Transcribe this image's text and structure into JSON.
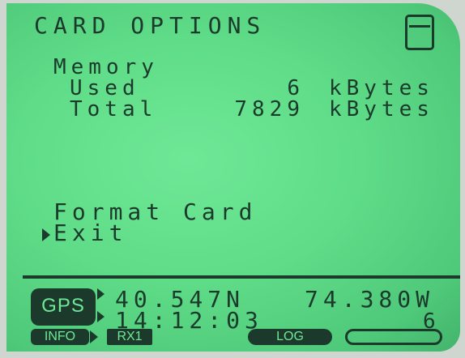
{
  "screen": {
    "title": "CARD OPTIONS"
  },
  "memory": {
    "label": "Memory",
    "used": {
      "label": "Used",
      "value": "6",
      "unit": "kBytes"
    },
    "total": {
      "label": "Total",
      "value": "7829",
      "unit": "kBytes"
    }
  },
  "menu": {
    "items": [
      {
        "label": "Format Card",
        "selected": false
      },
      {
        "label": "Exit",
        "selected": true
      }
    ]
  },
  "status": {
    "gps_label": "GPS",
    "latitude": "40.547N",
    "longitude": "74.380W",
    "time": "14:12:03",
    "satellites": "6",
    "info_label": "INFO",
    "rx_label": "RX1",
    "log_label": "LOG",
    "log_fill": 0.0
  },
  "icons": {
    "card": "sd-card-icon",
    "cursor": "menu-cursor-icon"
  },
  "colors": {
    "lcd_background": "#5fdc88",
    "lcd_ink": "#1c3a2c"
  }
}
